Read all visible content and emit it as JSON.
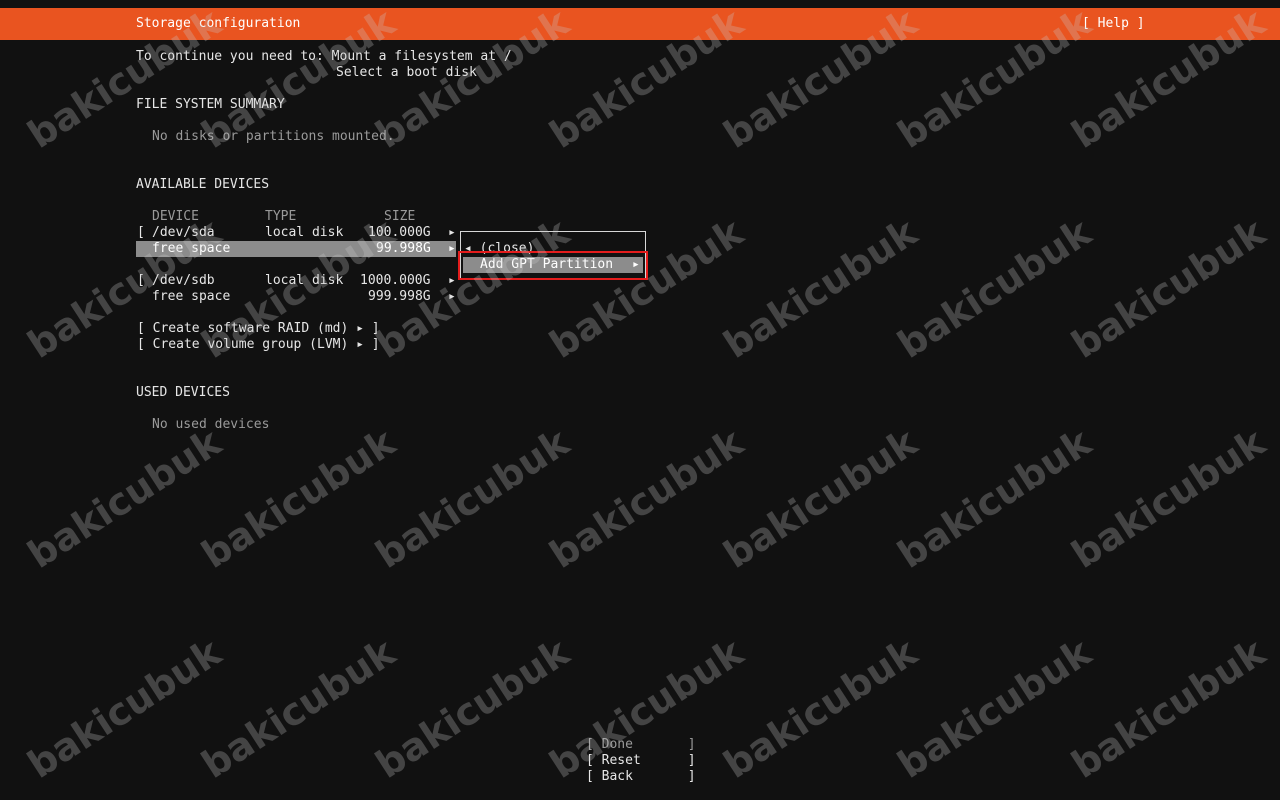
{
  "header": {
    "title": "Storage configuration",
    "help": "[ Help ]",
    "color": "#e95420"
  },
  "intro": {
    "line1": "To continue you need to: Mount a filesystem at /",
    "line2": "Select a boot disk"
  },
  "fs_summary": {
    "heading": "FILE SYSTEM SUMMARY",
    "empty": "No disks or partitions mounted."
  },
  "available": {
    "heading": "AVAILABLE DEVICES",
    "columns": {
      "device": "DEVICE",
      "type": "TYPE",
      "size": "SIZE"
    },
    "rows": [
      {
        "bracket": "[",
        "device": "/dev/sda",
        "type": "local disk",
        "size": "100.000G",
        "arrow": "▸"
      },
      {
        "bracket": "",
        "device": "free space",
        "type": "",
        "size": "99.998G",
        "arrow": "▸"
      },
      {
        "bracket": "[",
        "device": "/dev/sdb",
        "type": "local disk",
        "size": "1000.000G",
        "arrow": "▸"
      },
      {
        "bracket": "",
        "device": "free space",
        "type": "",
        "size": "999.998G",
        "arrow": "▸"
      }
    ],
    "actions": [
      "[ Create software RAID (md) ▸ ]",
      "[ Create volume group (LVM) ▸ ]"
    ]
  },
  "context_menu": {
    "close": "◂ (close)",
    "add": "Add GPT Partition",
    "add_arrow": "▸"
  },
  "used": {
    "heading": "USED DEVICES",
    "empty": "No used devices"
  },
  "buttons": {
    "done": "[ Done       ]",
    "reset": "[ Reset      ]",
    "back": "[ Back       ]"
  },
  "watermark": "bakicubuk"
}
